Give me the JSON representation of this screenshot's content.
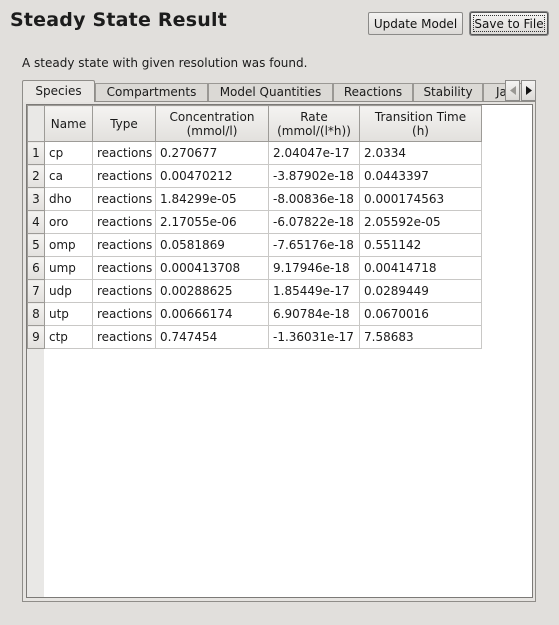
{
  "window": {
    "title": "Steady State Result",
    "update_button": "Update Model",
    "save_button": "Save to File"
  },
  "message": "A steady state with given resolution was found.",
  "tabs": [
    {
      "label": "Species",
      "active": true
    },
    {
      "label": "Compartments",
      "active": false
    },
    {
      "label": "Model Quantities",
      "active": false
    },
    {
      "label": "Reactions",
      "active": false
    },
    {
      "label": "Stability",
      "active": false
    },
    {
      "label": "Ja",
      "active": false
    }
  ],
  "icons": {
    "scroll_left": "triangle-left-icon",
    "scroll_right": "triangle-right-icon"
  },
  "table": {
    "columns": [
      {
        "line1": "Name",
        "line2": ""
      },
      {
        "line1": "Type",
        "line2": ""
      },
      {
        "line1": "Concentration",
        "line2": "(mmol/l)"
      },
      {
        "line1": "Rate",
        "line2": "(mmol/(l*h))"
      },
      {
        "line1": "Transition Time",
        "line2": "(h)"
      }
    ],
    "rows": [
      {
        "index": "1",
        "name": "cp",
        "type": "reactions",
        "concentration": "0.270677",
        "rate": "2.04047e-17",
        "transition_time": "2.0334"
      },
      {
        "index": "2",
        "name": "ca",
        "type": "reactions",
        "concentration": "0.00470212",
        "rate": "-3.87902e-18",
        "transition_time": "0.0443397"
      },
      {
        "index": "3",
        "name": "dho",
        "type": "reactions",
        "concentration": "1.84299e-05",
        "rate": "-8.00836e-18",
        "transition_time": "0.000174563"
      },
      {
        "index": "4",
        "name": "oro",
        "type": "reactions",
        "concentration": "2.17055e-06",
        "rate": "-6.07822e-18",
        "transition_time": "2.05592e-05"
      },
      {
        "index": "5",
        "name": "omp",
        "type": "reactions",
        "concentration": "0.0581869",
        "rate": "-7.65176e-18",
        "transition_time": "0.551142"
      },
      {
        "index": "6",
        "name": "ump",
        "type": "reactions",
        "concentration": "0.000413708",
        "rate": "9.17946e-18",
        "transition_time": "0.00414718"
      },
      {
        "index": "7",
        "name": "udp",
        "type": "reactions",
        "concentration": "0.00288625",
        "rate": "1.85449e-17",
        "transition_time": "0.0289449"
      },
      {
        "index": "8",
        "name": "utp",
        "type": "reactions",
        "concentration": "0.00666174",
        "rate": "6.90784e-18",
        "transition_time": "0.0670016"
      },
      {
        "index": "9",
        "name": "ctp",
        "type": "reactions",
        "concentration": "0.747454",
        "rate": "-1.36031e-17",
        "transition_time": "7.58683"
      }
    ]
  }
}
